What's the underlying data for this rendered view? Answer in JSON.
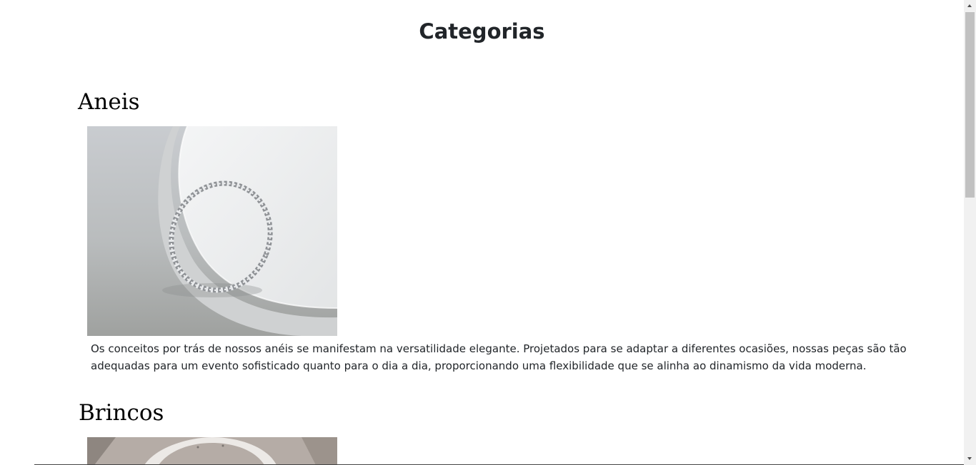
{
  "page": {
    "title": "Categorias"
  },
  "categories": [
    {
      "name": "Aneis",
      "image_icon": "ring-image",
      "description": "Os conceitos por trás de nossos anéis se manifestam na versatilidade elegante. Projetados para se adaptar a diferentes ocasiões, nossas peças são tão adequadas para um evento sofisticado quanto para o dia a dia, proporcionando uma flexibilidade que se alinha ao dinamismo da vida moderna."
    },
    {
      "name": "Brincos",
      "image_icon": "earring-image"
    }
  ],
  "colors": {
    "text": "#212529",
    "heading": "#000000",
    "background": "#ffffff",
    "scrollbar_track": "#f1f1f1",
    "scrollbar_thumb": "#c1c1c1"
  }
}
